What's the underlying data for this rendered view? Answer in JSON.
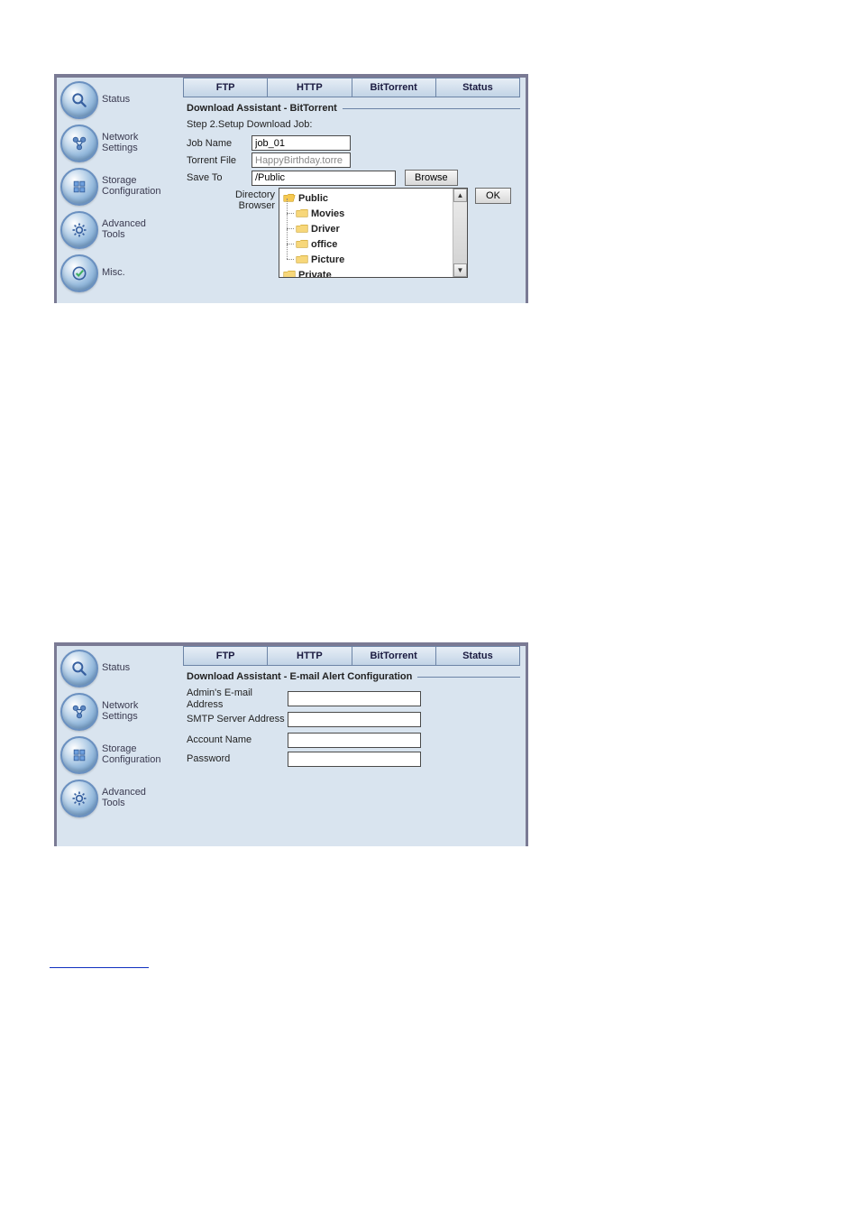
{
  "sidebar": {
    "items": [
      {
        "label": "Status"
      },
      {
        "label": "Network\nSettings"
      },
      {
        "label": "Storage\nConfiguration"
      },
      {
        "label": "Advanced\nTools"
      },
      {
        "label": "Misc."
      }
    ]
  },
  "tabs": [
    "FTP",
    "HTTP",
    "BitTorrent",
    "Status"
  ],
  "panel1": {
    "section_title": "Download Assistant - BitTorrent",
    "step_text": "Step 2.Setup Download Job:",
    "job_name_label": "Job Name",
    "job_name_value": "job_01",
    "torrent_file_label": "Torrent File",
    "torrent_file_value": "HappyBirthday.torre",
    "save_to_label": "Save To",
    "save_to_value": "/Public",
    "browse_label": "Browse",
    "dir_browser_label": "Directory\nBrowser",
    "ok_label": "OK",
    "tree": {
      "root": "Public",
      "children": [
        "Movies",
        "Driver",
        "office",
        "Picture"
      ],
      "sibling": "Private"
    }
  },
  "panel2": {
    "section_title": "Download Assistant - E-mail Alert Configuration",
    "fields": [
      {
        "label": "Admin's E-mail Address",
        "value": ""
      },
      {
        "label": "SMTP Server Address",
        "value": ""
      },
      {
        "label": "Account Name",
        "value": ""
      },
      {
        "label": "Password",
        "value": ""
      }
    ]
  }
}
